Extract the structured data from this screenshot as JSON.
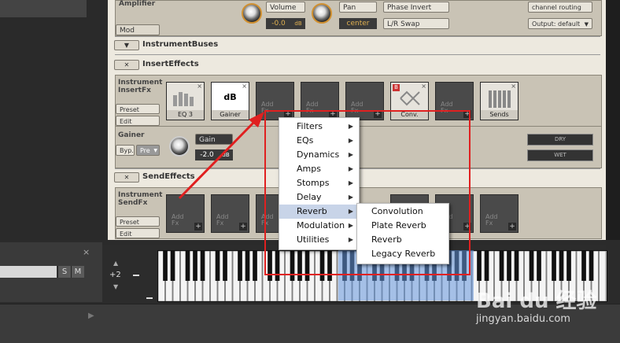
{
  "left": {
    "close": "×",
    "s": "S",
    "m": "M"
  },
  "amplifier": {
    "title": "Amplifier",
    "mod": "Mod",
    "volume_label": "Volume",
    "volume_value": "-0.0",
    "volume_unit": "dB",
    "pan_label": "Pan",
    "pan_value": "center",
    "phase_invert": "Phase Invert",
    "lr_swap": "L/R Swap",
    "channel_routing": "channel routing",
    "output": "Output: default"
  },
  "instrument_buses": {
    "title": "InstrumentBuses"
  },
  "insert_effects": {
    "title": "InsertEffects",
    "side_label_1": "Instrument",
    "side_label_2": "InsertFx",
    "preset": "Preset",
    "edit": "Edit",
    "slots": [
      {
        "name": "EQ 3",
        "type": "eq"
      },
      {
        "name": "Gainer",
        "type": "db",
        "big": "dB"
      },
      {
        "name": "",
        "type": "empty"
      },
      {
        "name": "",
        "type": "empty"
      },
      {
        "name": "",
        "type": "empty"
      },
      {
        "name": "Conv.",
        "type": "conv",
        "badge": "B"
      },
      {
        "name": "",
        "type": "empty"
      },
      {
        "name": "Sends",
        "type": "sends"
      }
    ],
    "add_fx_1": "Add",
    "add_fx_2": "Fx"
  },
  "gainer": {
    "title": "Gainer",
    "byp": "Byp.",
    "pre": "Pre",
    "gain_label": "Gain",
    "gain_value": "-2.0",
    "gain_unit": "dB",
    "dry": "DRY",
    "wet": "WET"
  },
  "send_effects": {
    "title": "SendEffects",
    "side_label_1": "Instrument",
    "side_label_2": "SendFx",
    "preset": "Preset",
    "edit": "Edit"
  },
  "keyboard": {
    "transpose": "+2"
  },
  "menu": {
    "items": [
      {
        "label": "Filters"
      },
      {
        "label": "EQs"
      },
      {
        "label": "Dynamics"
      },
      {
        "label": "Amps"
      },
      {
        "label": "Stomps"
      },
      {
        "label": "Delay"
      },
      {
        "label": "Reverb",
        "active": true
      },
      {
        "label": "Modulation"
      },
      {
        "label": "Utilities"
      }
    ],
    "submenu": [
      {
        "label": "Convolution"
      },
      {
        "label": "Plate Reverb"
      },
      {
        "label": "Reverb"
      },
      {
        "label": "Legacy Reverb"
      }
    ]
  },
  "watermark": {
    "logo": "Bai du 经验",
    "url": "jingyan.baidu.com"
  },
  "colors": {
    "annotation": "#e02020",
    "menu_highlight": "#c8d4e8",
    "knob_ring": "#d09030"
  }
}
